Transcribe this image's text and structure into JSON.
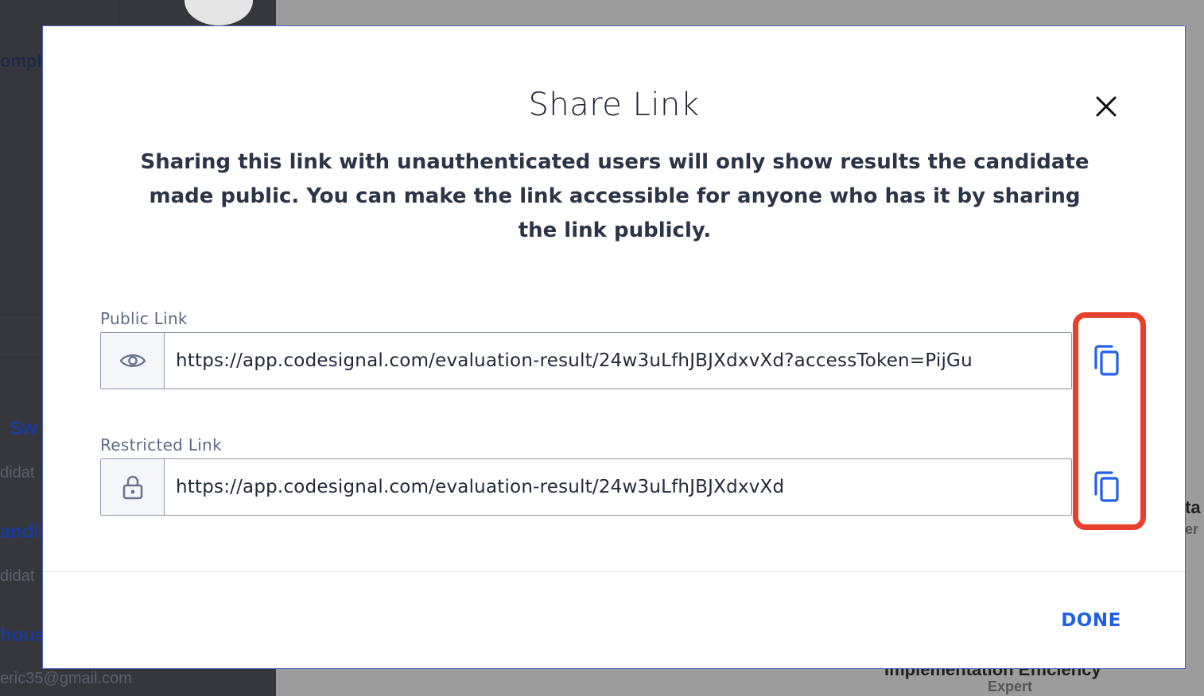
{
  "background": {
    "sidebar_fragments": [
      "ompl",
      "Sw",
      "didat",
      "andi",
      "didat",
      "hous",
      "eric35@gmail.com"
    ],
    "main_fragments": [
      "ta",
      "er",
      "Implementation Efficiency",
      "Expert"
    ]
  },
  "modal": {
    "title": "Share Link",
    "close_icon": "close-icon",
    "description": "Sharing this link with unauthenticated users will only show results the candidate made public. You can make the link accessible for anyone who has it by sharing the link publicly.",
    "public_link": {
      "label": "Public Link",
      "icon": "eye-icon",
      "value": "https://app.codesignal.com/evaluation-result/24w3uLfhJBJXdxvXd?accessToken=PijGu",
      "copy_icon": "copy-icon"
    },
    "restricted_link": {
      "label": "Restricted Link",
      "icon": "lock-icon",
      "value": "https://app.codesignal.com/evaluation-result/24w3uLfhJBJXdxvXd",
      "copy_icon": "copy-icon"
    },
    "done_label": "DONE"
  },
  "colors": {
    "accent": "#2060e6",
    "highlight": "#e8402e",
    "text": "#2c3447"
  }
}
